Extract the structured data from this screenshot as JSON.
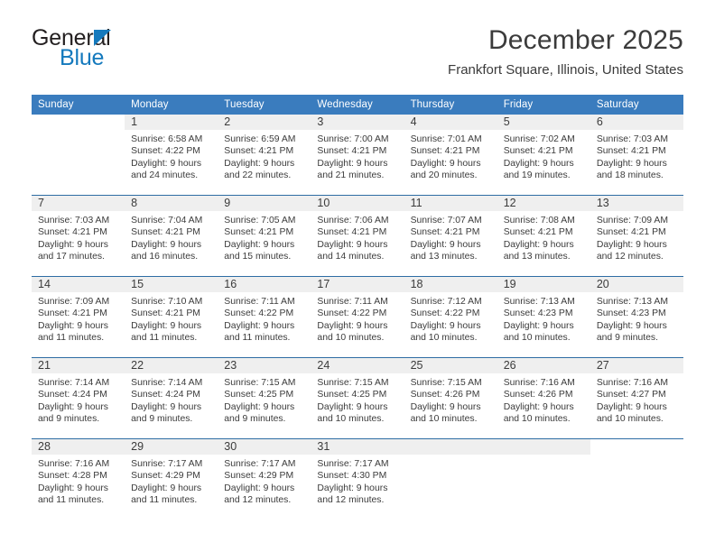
{
  "logo": {
    "line1": "General",
    "line2": "Blue",
    "triangle": "blue-triangle-icon",
    "colors": {
      "dark": "#231f20",
      "blue": "#1479bd"
    }
  },
  "header": {
    "title": "December 2025",
    "location": "Frankfort Square, Illinois, United States"
  },
  "theme": {
    "header_blue": "#3a7cbe",
    "separator_blue": "#2e6da4",
    "band_gray": "#efefef",
    "text": "#3b3b3b"
  },
  "weekday_headers": [
    "Sunday",
    "Monday",
    "Tuesday",
    "Wednesday",
    "Thursday",
    "Friday",
    "Saturday"
  ],
  "weeks": [
    [
      {
        "day": "",
        "sunrise": "",
        "sunset": "",
        "daylight_line1": "",
        "daylight_line2": ""
      },
      {
        "day": "1",
        "sunrise": "Sunrise: 6:58 AM",
        "sunset": "Sunset: 4:22 PM",
        "daylight_line1": "Daylight: 9 hours",
        "daylight_line2": "and 24 minutes."
      },
      {
        "day": "2",
        "sunrise": "Sunrise: 6:59 AM",
        "sunset": "Sunset: 4:21 PM",
        "daylight_line1": "Daylight: 9 hours",
        "daylight_line2": "and 22 minutes."
      },
      {
        "day": "3",
        "sunrise": "Sunrise: 7:00 AM",
        "sunset": "Sunset: 4:21 PM",
        "daylight_line1": "Daylight: 9 hours",
        "daylight_line2": "and 21 minutes."
      },
      {
        "day": "4",
        "sunrise": "Sunrise: 7:01 AM",
        "sunset": "Sunset: 4:21 PM",
        "daylight_line1": "Daylight: 9 hours",
        "daylight_line2": "and 20 minutes."
      },
      {
        "day": "5",
        "sunrise": "Sunrise: 7:02 AM",
        "sunset": "Sunset: 4:21 PM",
        "daylight_line1": "Daylight: 9 hours",
        "daylight_line2": "and 19 minutes."
      },
      {
        "day": "6",
        "sunrise": "Sunrise: 7:03 AM",
        "sunset": "Sunset: 4:21 PM",
        "daylight_line1": "Daylight: 9 hours",
        "daylight_line2": "and 18 minutes."
      }
    ],
    [
      {
        "day": "7",
        "sunrise": "Sunrise: 7:03 AM",
        "sunset": "Sunset: 4:21 PM",
        "daylight_line1": "Daylight: 9 hours",
        "daylight_line2": "and 17 minutes."
      },
      {
        "day": "8",
        "sunrise": "Sunrise: 7:04 AM",
        "sunset": "Sunset: 4:21 PM",
        "daylight_line1": "Daylight: 9 hours",
        "daylight_line2": "and 16 minutes."
      },
      {
        "day": "9",
        "sunrise": "Sunrise: 7:05 AM",
        "sunset": "Sunset: 4:21 PM",
        "daylight_line1": "Daylight: 9 hours",
        "daylight_line2": "and 15 minutes."
      },
      {
        "day": "10",
        "sunrise": "Sunrise: 7:06 AM",
        "sunset": "Sunset: 4:21 PM",
        "daylight_line1": "Daylight: 9 hours",
        "daylight_line2": "and 14 minutes."
      },
      {
        "day": "11",
        "sunrise": "Sunrise: 7:07 AM",
        "sunset": "Sunset: 4:21 PM",
        "daylight_line1": "Daylight: 9 hours",
        "daylight_line2": "and 13 minutes."
      },
      {
        "day": "12",
        "sunrise": "Sunrise: 7:08 AM",
        "sunset": "Sunset: 4:21 PM",
        "daylight_line1": "Daylight: 9 hours",
        "daylight_line2": "and 13 minutes."
      },
      {
        "day": "13",
        "sunrise": "Sunrise: 7:09 AM",
        "sunset": "Sunset: 4:21 PM",
        "daylight_line1": "Daylight: 9 hours",
        "daylight_line2": "and 12 minutes."
      }
    ],
    [
      {
        "day": "14",
        "sunrise": "Sunrise: 7:09 AM",
        "sunset": "Sunset: 4:21 PM",
        "daylight_line1": "Daylight: 9 hours",
        "daylight_line2": "and 11 minutes."
      },
      {
        "day": "15",
        "sunrise": "Sunrise: 7:10 AM",
        "sunset": "Sunset: 4:21 PM",
        "daylight_line1": "Daylight: 9 hours",
        "daylight_line2": "and 11 minutes."
      },
      {
        "day": "16",
        "sunrise": "Sunrise: 7:11 AM",
        "sunset": "Sunset: 4:22 PM",
        "daylight_line1": "Daylight: 9 hours",
        "daylight_line2": "and 11 minutes."
      },
      {
        "day": "17",
        "sunrise": "Sunrise: 7:11 AM",
        "sunset": "Sunset: 4:22 PM",
        "daylight_line1": "Daylight: 9 hours",
        "daylight_line2": "and 10 minutes."
      },
      {
        "day": "18",
        "sunrise": "Sunrise: 7:12 AM",
        "sunset": "Sunset: 4:22 PM",
        "daylight_line1": "Daylight: 9 hours",
        "daylight_line2": "and 10 minutes."
      },
      {
        "day": "19",
        "sunrise": "Sunrise: 7:13 AM",
        "sunset": "Sunset: 4:23 PM",
        "daylight_line1": "Daylight: 9 hours",
        "daylight_line2": "and 10 minutes."
      },
      {
        "day": "20",
        "sunrise": "Sunrise: 7:13 AM",
        "sunset": "Sunset: 4:23 PM",
        "daylight_line1": "Daylight: 9 hours",
        "daylight_line2": "and 9 minutes."
      }
    ],
    [
      {
        "day": "21",
        "sunrise": "Sunrise: 7:14 AM",
        "sunset": "Sunset: 4:24 PM",
        "daylight_line1": "Daylight: 9 hours",
        "daylight_line2": "and 9 minutes."
      },
      {
        "day": "22",
        "sunrise": "Sunrise: 7:14 AM",
        "sunset": "Sunset: 4:24 PM",
        "daylight_line1": "Daylight: 9 hours",
        "daylight_line2": "and 9 minutes."
      },
      {
        "day": "23",
        "sunrise": "Sunrise: 7:15 AM",
        "sunset": "Sunset: 4:25 PM",
        "daylight_line1": "Daylight: 9 hours",
        "daylight_line2": "and 9 minutes."
      },
      {
        "day": "24",
        "sunrise": "Sunrise: 7:15 AM",
        "sunset": "Sunset: 4:25 PM",
        "daylight_line1": "Daylight: 9 hours",
        "daylight_line2": "and 10 minutes."
      },
      {
        "day": "25",
        "sunrise": "Sunrise: 7:15 AM",
        "sunset": "Sunset: 4:26 PM",
        "daylight_line1": "Daylight: 9 hours",
        "daylight_line2": "and 10 minutes."
      },
      {
        "day": "26",
        "sunrise": "Sunrise: 7:16 AM",
        "sunset": "Sunset: 4:26 PM",
        "daylight_line1": "Daylight: 9 hours",
        "daylight_line2": "and 10 minutes."
      },
      {
        "day": "27",
        "sunrise": "Sunrise: 7:16 AM",
        "sunset": "Sunset: 4:27 PM",
        "daylight_line1": "Daylight: 9 hours",
        "daylight_line2": "and 10 minutes."
      }
    ],
    [
      {
        "day": "28",
        "sunrise": "Sunrise: 7:16 AM",
        "sunset": "Sunset: 4:28 PM",
        "daylight_line1": "Daylight: 9 hours",
        "daylight_line2": "and 11 minutes."
      },
      {
        "day": "29",
        "sunrise": "Sunrise: 7:17 AM",
        "sunset": "Sunset: 4:29 PM",
        "daylight_line1": "Daylight: 9 hours",
        "daylight_line2": "and 11 minutes."
      },
      {
        "day": "30",
        "sunrise": "Sunrise: 7:17 AM",
        "sunset": "Sunset: 4:29 PM",
        "daylight_line1": "Daylight: 9 hours",
        "daylight_line2": "and 12 minutes."
      },
      {
        "day": "31",
        "sunrise": "Sunrise: 7:17 AM",
        "sunset": "Sunset: 4:30 PM",
        "daylight_line1": "Daylight: 9 hours",
        "daylight_line2": "and 12 minutes."
      },
      {
        "day": "",
        "sunrise": "",
        "sunset": "",
        "daylight_line1": "",
        "daylight_line2": ""
      },
      {
        "day": "",
        "sunrise": "",
        "sunset": "",
        "daylight_line1": "",
        "daylight_line2": ""
      },
      {
        "day": "",
        "sunrise": "",
        "sunset": "",
        "daylight_line1": "",
        "daylight_line2": ""
      }
    ]
  ]
}
